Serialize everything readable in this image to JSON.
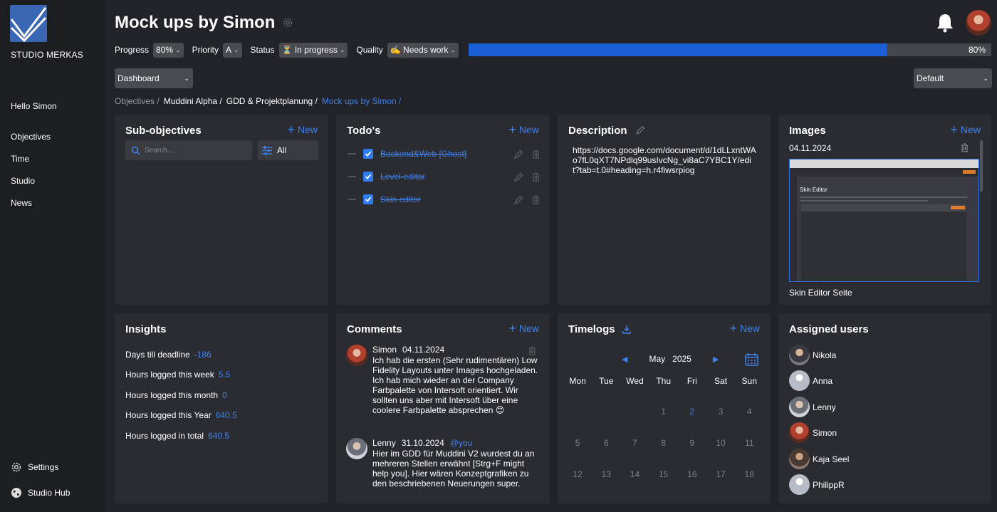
{
  "sidebar": {
    "studio_name": "STUDIO MERKAS",
    "greeting": "Hello Simon",
    "nav": [
      "Objectives",
      "Time",
      "Studio",
      "News"
    ],
    "settings_label": "Settings",
    "hub_label": "Studio Hub"
  },
  "header": {
    "title": "Mock ups by Simon",
    "progress_label": "Progress",
    "progress_value": "80%",
    "progress_fraction": 0.8,
    "priority_label": "Priority",
    "priority_value": "A",
    "status_label": "Status",
    "status_value": "⏳ In progress",
    "quality_label": "Quality",
    "quality_value": "✍️ Needs work",
    "progress_bar_text": "80%"
  },
  "view_select": "Dashboard",
  "layout_select": "Default",
  "breadcrumb": {
    "c1": "Objectives /",
    "c2": "Muddini Alpha /",
    "c3": "GDD & Projektplanung /",
    "c4": "Mock ups by Simon /"
  },
  "subobjectives": {
    "title": "Sub-objectives",
    "new_label": "New",
    "search_placeholder": "Search...",
    "filter_label": "All"
  },
  "todos": {
    "title": "Todo's",
    "new_label": "New",
    "items": [
      "Backend&Web [Ghost]",
      "Level-editor",
      "Skin editor"
    ]
  },
  "description": {
    "title": "Description",
    "text": "https://docs.google.com/document/d/1dLLxntWAo7fL0qXT7NPdlq99usIvcNg_vi8aC7YBC1Y/edit?tab=t.0#heading=h.r4fiwsrpiog"
  },
  "images": {
    "title": "Images",
    "new_label": "New",
    "date": "04.11.2024",
    "thumb_heading": "Skin Editor",
    "caption": "Skin Editor Seite"
  },
  "insights": {
    "title": "Insights",
    "rows": [
      {
        "label": "Days till deadline",
        "value": "-186"
      },
      {
        "label": "Hours logged this week",
        "value": "5.5"
      },
      {
        "label": "Hours logged this month",
        "value": "0"
      },
      {
        "label": "Hours logged this Year",
        "value": "640.5"
      },
      {
        "label": "Hours logged in total",
        "value": "640.5"
      }
    ]
  },
  "comments": {
    "title": "Comments",
    "new_label": "New",
    "items": [
      {
        "author": "Simon",
        "date": "04.11.2024",
        "tag": "",
        "text": "Ich hab die ersten (Sehr rudimentären) Low Fidelity Layouts unter Images hochgeladen. Ich hab mich wieder an der Company Farbpalette von Intersoft orientiert. Wir sollten uns aber mit Intersoft über eine coolere Farbpalette absprechen 😊"
      },
      {
        "author": "Lenny",
        "date": "31.10.2024",
        "tag": "@you",
        "text": "Hier im GDD für Muddini V2 wurdest du an mehreren Stellen erwähnt [Strg+F might help you]. Hier wären Konzeptgrafiken zu den beschriebenen Neuerungen super."
      }
    ]
  },
  "timelogs": {
    "title": "Timelogs",
    "new_label": "New",
    "month": "May",
    "year": "2025",
    "dow": [
      "Mon",
      "Tue",
      "Wed",
      "Thu",
      "Fri",
      "Sat",
      "Sun"
    ],
    "weeks": [
      [
        "",
        "",
        "",
        "1",
        "2",
        "3",
        "4"
      ],
      [
        "5",
        "6",
        "7",
        "8",
        "9",
        "10",
        "11"
      ],
      [
        "12",
        "13",
        "14",
        "15",
        "16",
        "17",
        "18"
      ]
    ],
    "highlight_day": "2"
  },
  "assigned": {
    "title": "Assigned users",
    "users": [
      "Nikola",
      "Anna",
      "Lenny",
      "Simon",
      "Kaja Seel",
      "PhilippR"
    ]
  },
  "colors": {
    "accent": "#3d82f0",
    "progress": "#1b5fd8",
    "card": "#2b2c31",
    "background": "#222328"
  }
}
